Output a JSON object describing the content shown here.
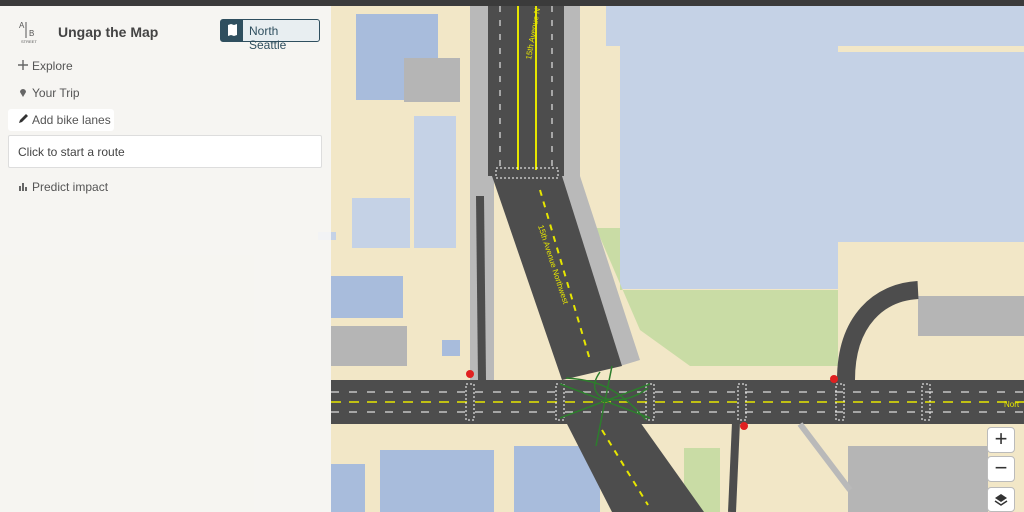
{
  "app": {
    "title": "Ungap the Map",
    "logo_text_a": "A",
    "logo_text_b": "B",
    "logo_text_street": "STREET"
  },
  "region_button": {
    "label": "North Seattle",
    "icon": "map-icon"
  },
  "nav": [
    {
      "label": "Explore",
      "icon": "move-icon"
    },
    {
      "label": "Your Trip",
      "icon": "pin-icon"
    },
    {
      "label": "Add bike lanes",
      "icon": "pencil-icon",
      "active": true
    },
    {
      "label": "Predict impact",
      "icon": "bar-chart-icon"
    }
  ],
  "route_box": {
    "text": "Click to start a route"
  },
  "map": {
    "street_label_1": "15th Avenue N",
    "street_label_2": "15th Avenue Northwest",
    "street_label_3": "Nort",
    "zoom_in": "+",
    "zoom_out": "−",
    "layers_icon": "layers-icon"
  },
  "colors": {
    "land": "#f2e7c7",
    "building": "#c5d2e6",
    "road": "#4d4d4d",
    "park": "#c9dca5",
    "accent": "#2f4f5f"
  }
}
